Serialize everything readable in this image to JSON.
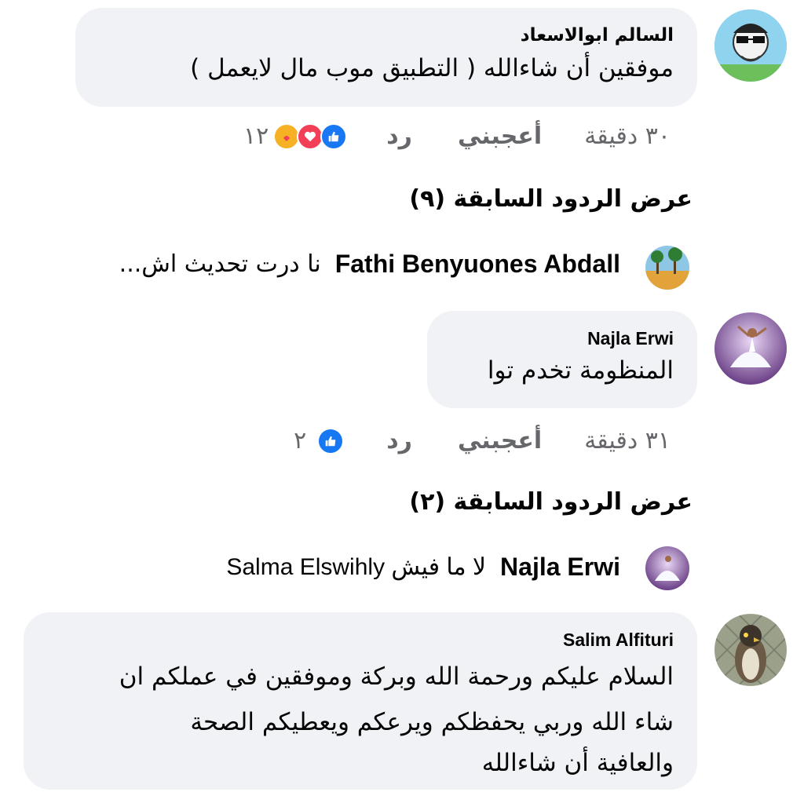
{
  "comments": [
    {
      "author": "السالم ابوالاسعاد",
      "text_lines": [
        "موفقين أن شاءالله ( التطبيق موب مال لايعمل )"
      ],
      "time": "٣٠ دقيقة",
      "like_label": "أعجبني",
      "reply_label": "رد",
      "reactions": [
        "like-icon",
        "love-icon",
        "care-icon"
      ],
      "reaction_count": "١٢",
      "view_previous": "عرض الردود السابقة (٩)",
      "reply_preview": {
        "name": "Fathi Benyuones Abdall",
        "text": "نا درت تحديث اش..."
      }
    },
    {
      "author": "Najla Erwi",
      "text_lines": [
        "المنظومة تخدم توا"
      ],
      "time": "٣١ دقيقة",
      "like_label": "أعجبني",
      "reply_label": "رد",
      "reactions": [
        "like-icon"
      ],
      "reaction_count": "٢",
      "view_previous": "عرض الردود السابقة (٢)",
      "reply_preview": {
        "name": "Najla Erwi",
        "text": "لا ما فيش Salma Elswihly"
      }
    },
    {
      "author": "Salim Alfituri",
      "text_lines": [
        "السلام عليكم ورحمة الله وبركة وموفقين في عملكم ان",
        "شاء الله وربي يحفظكم ويرعكم ويعطيكم الصحة",
        "والعافية أن شاءالله"
      ]
    }
  ],
  "colors": {
    "bubble": "#f0f2f5",
    "muted": "#65676b",
    "like": "#1877f2",
    "love": "#f33e58",
    "care": "#f7b125"
  }
}
